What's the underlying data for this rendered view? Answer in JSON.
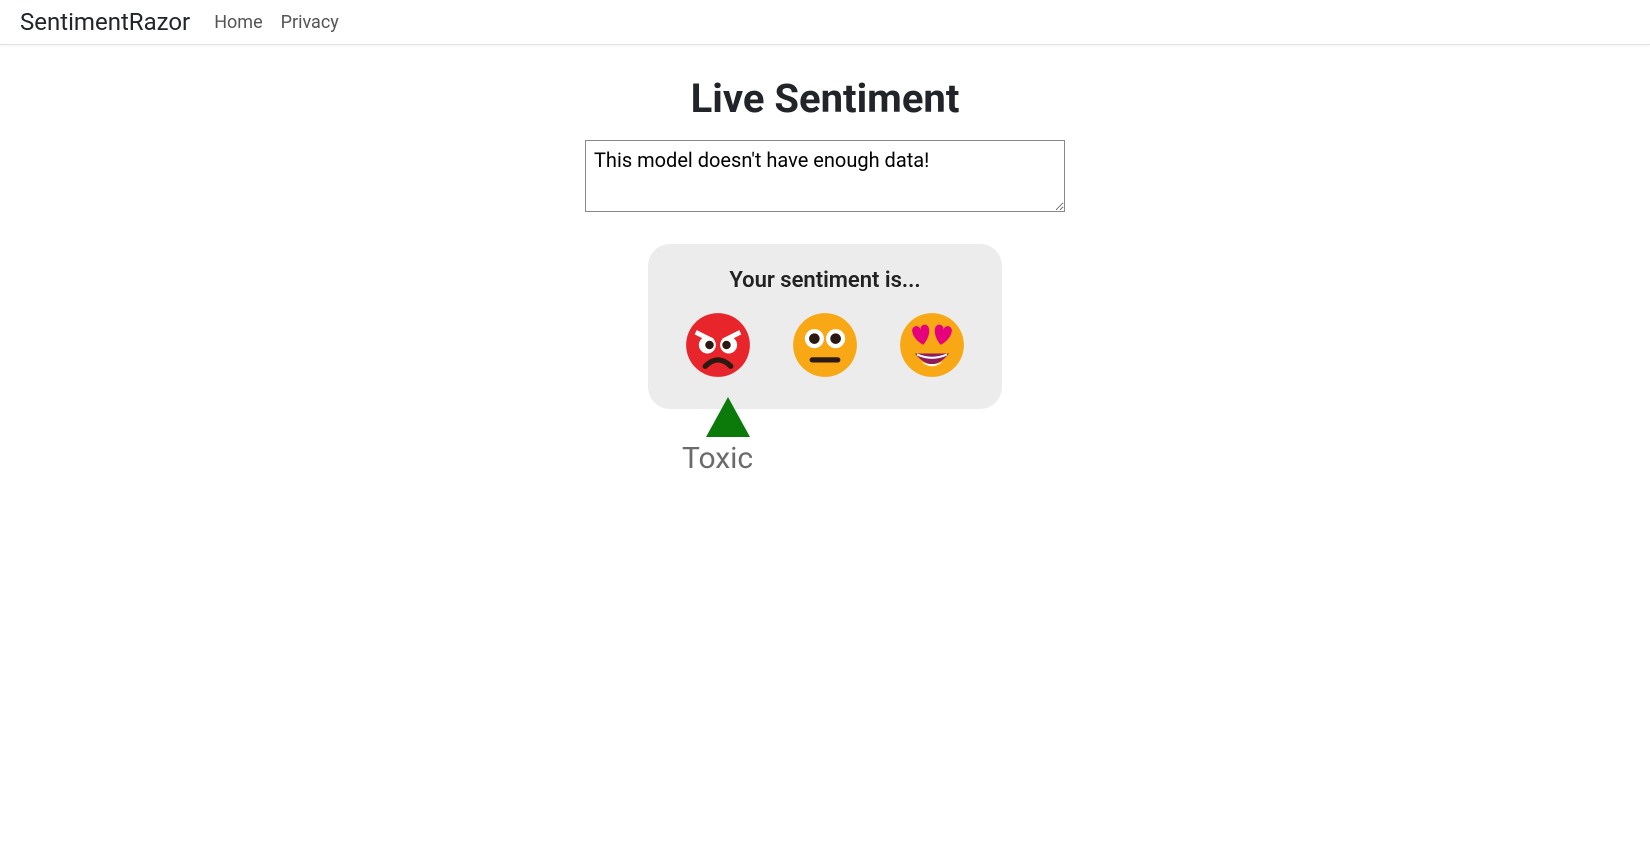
{
  "nav": {
    "brand": "SentimentRazor",
    "links": [
      {
        "label": "Home"
      },
      {
        "label": "Privacy"
      }
    ]
  },
  "page": {
    "title": "Live Sentiment",
    "input_value": "This model doesn't have enough data!"
  },
  "card": {
    "title": "Your sentiment is..."
  },
  "marker": {
    "label": "Toxic",
    "color": "#0b7a0b"
  },
  "emojis": {
    "angry": "angry-face-icon",
    "neutral": "neutral-face-icon",
    "love": "heart-eyes-face-icon"
  }
}
